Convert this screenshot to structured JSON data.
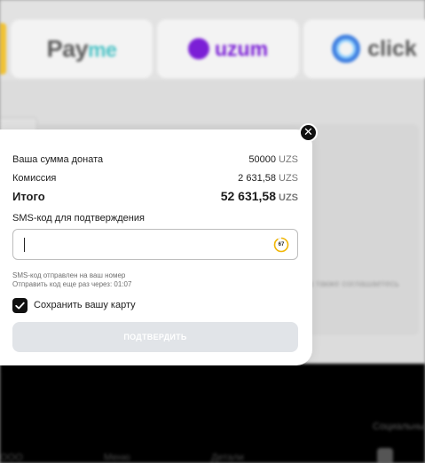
{
  "background": {
    "providers": [
      {
        "name": "Payme",
        "icon": "payme-logo",
        "text_a": "Pay",
        "text_b": "me"
      },
      {
        "name": "uzum",
        "icon": "uzum-logo",
        "text": "uzum"
      },
      {
        "name": "click",
        "icon": "click-logo",
        "text": "click"
      }
    ],
    "faint_text": ", а также соглашаетесь",
    "footer": {
      "social": "Социальные",
      "col1": "ООО",
      "col2": "Меню",
      "col3": "Детали"
    }
  },
  "modal": {
    "donation_label": "Ваша сумма доната",
    "donation_value": "50000",
    "commission_label": "Комиссия",
    "commission_value": "2 631,58",
    "total_label": "Итого",
    "total_value": "52 631,58",
    "currency": "UZS",
    "sms_label": "SMS-код для подтверждения",
    "sms_value": "",
    "timer_value": "67",
    "sms_sent_hint": "SMS-код отправлен на ваш номер",
    "resend_hint": "Отправить код еще раз через: 01:07",
    "save_card_label": "Сохранить вашу карту",
    "save_card_checked": true,
    "submit_label": "ПОДТВЕРДИТЬ",
    "close_icon": "close-icon"
  },
  "colors": {
    "accent_dark": "#111111",
    "timer_ring": "#f2b705",
    "button_disabled": "#e1e4e8",
    "uzum_purple": "#7b1fd6",
    "click_blue": "#3f7fe0"
  }
}
